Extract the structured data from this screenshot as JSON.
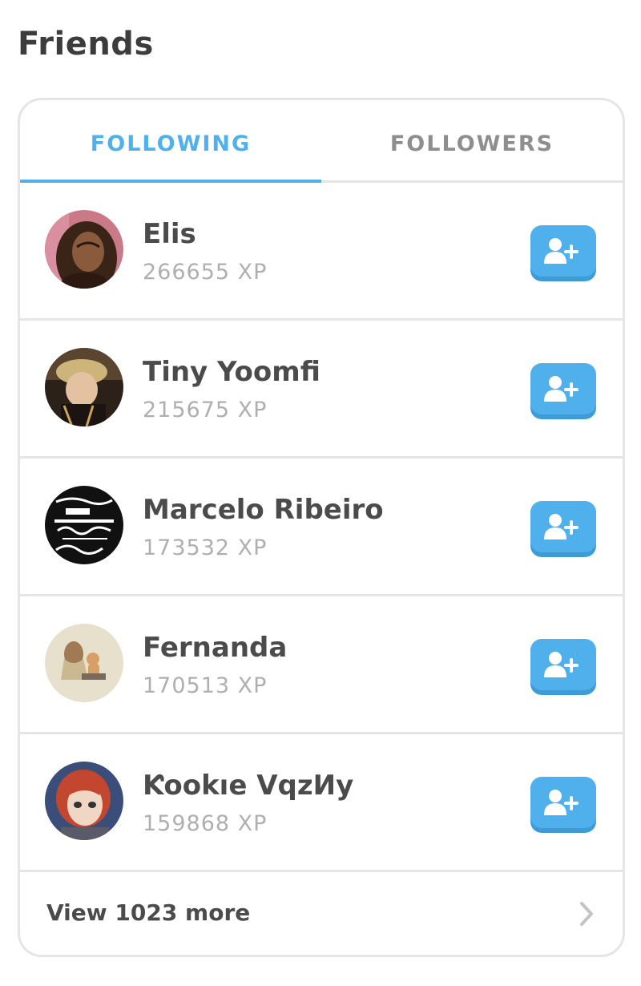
{
  "page_title": "Friends",
  "tabs": [
    {
      "label": "FOLLOWING",
      "active": true
    },
    {
      "label": "FOLLOWERS",
      "active": false
    }
  ],
  "friends": [
    {
      "name": "Elis",
      "xp": "266655 XP",
      "avatar": "photo-avatar-woman"
    },
    {
      "name": "Tiny Yoomfi",
      "xp": "215675 XP",
      "avatar": "photo-avatar-man"
    },
    {
      "name": "Marcelo Ribeiro",
      "xp": "173532 XP",
      "avatar": "text-art-avatar"
    },
    {
      "name": "Fernanda",
      "xp": "170513 XP",
      "avatar": "illustration-avatar"
    },
    {
      "name": "Ƙookıe VqzИy",
      "xp": "159868 XP",
      "avatar": "anime-avatar"
    }
  ],
  "follow_button_icon": "add-user-icon",
  "footer": {
    "label": "View 1023 more",
    "icon": "chevron-right-icon"
  },
  "colors": {
    "accent": "#4fb0ec",
    "button_shadow": "#3d9bd6",
    "text_dark": "#4b4b4b",
    "text_muted": "#afafaf",
    "border": "#e5e5e5"
  }
}
